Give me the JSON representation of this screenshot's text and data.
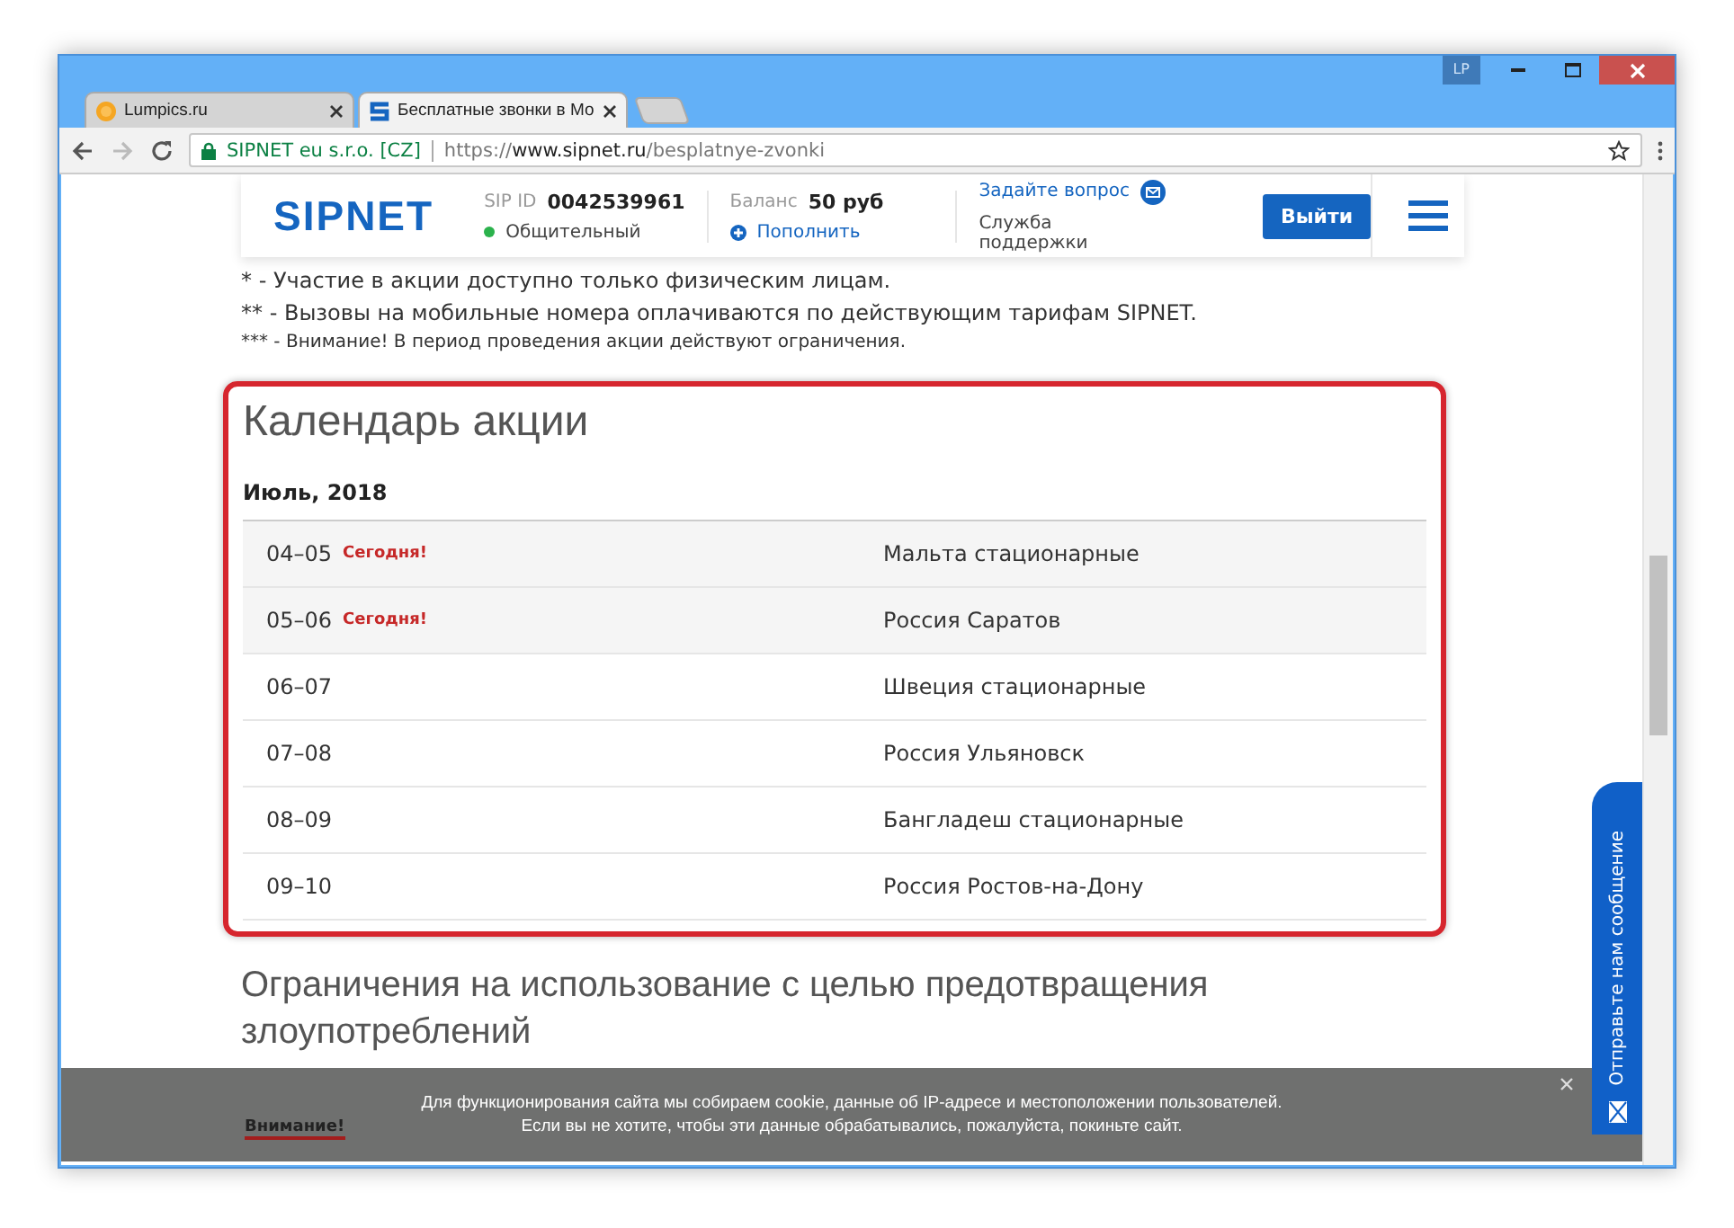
{
  "window": {
    "profile_badge": "LP"
  },
  "tabs": [
    {
      "title": "Lumpics.ru",
      "kind": "circle",
      "selected": false
    },
    {
      "title": "Бесплатные звонки в Мо",
      "kind": "letter",
      "selected": true
    }
  ],
  "address_bar": {
    "site_identity": "SIPNET eu s.r.o. [CZ]",
    "url_scheme": "https://",
    "url_host": "www.sipnet.ru",
    "url_path": "/besplatnye-zvonki"
  },
  "site_header": {
    "logo": "SIPNET",
    "sip_id_label": "SIP ID",
    "sip_id": "0042539961",
    "status": "Общительный",
    "balance_label": "Баланс",
    "balance": "50 руб",
    "top_up": "Пополнить",
    "ask": "Задайте вопрос",
    "support": "Служба поддержки",
    "logout": "Выйти"
  },
  "notes": [
    {
      "text": "* - Участие в акции доступно только физическим лицам.",
      "kind": "normal"
    },
    {
      "text": "** - Вызовы на мобильные номера оплачиваются по действующим тарифам SIPNET.",
      "kind": "normal"
    },
    {
      "text": "*** - Внимание! В период проведения акции действуют ограничения.",
      "kind": "small"
    }
  ],
  "calendar": {
    "title": "Календарь акции",
    "month": "Июль, 2018",
    "rows": [
      {
        "dates": "04–05",
        "badge": "Сегодня!",
        "destination": "Мальта стационарные"
      },
      {
        "dates": "05–06",
        "badge": "Сегодня!",
        "destination": "Россия Саратов"
      },
      {
        "dates": "06–07",
        "destination": "Швеция стационарные"
      },
      {
        "dates": "07–08",
        "destination": "Россия Ульяновск"
      },
      {
        "dates": "08–09",
        "destination": "Бангладеш стационарные"
      },
      {
        "dates": "09–10",
        "destination": "Россия Ростов-на-Дону"
      }
    ]
  },
  "restrictions_heading": "Ограничения на использование с целью предотвращения злоупотреблений",
  "cookie_banner": {
    "text": "Для функционирования сайта мы собираем cookie, данные об IP-адресе и местоположении пользователей. Если вы не хотите, чтобы эти данные обрабатывались, пожалуйста, покиньте сайт.",
    "link": "Внимание!"
  },
  "feedback_tab": "Отправьте нам сообщение"
}
